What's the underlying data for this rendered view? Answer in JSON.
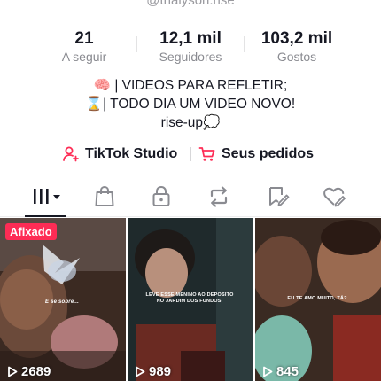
{
  "profile": {
    "handle": "@thaiyson.rise"
  },
  "stats": [
    {
      "value": "21",
      "label": "A seguir"
    },
    {
      "value": "12,1 mil",
      "label": "Seguidores"
    },
    {
      "value": "103,2 mil",
      "label": "Gostos"
    }
  ],
  "bio": {
    "line1": "🧠 | VIDEOS PARA REFLETIR;",
    "line2": "⌛| TODO DIA UM VIDEO NOVO!",
    "line3": "rise-up💭"
  },
  "actions": {
    "studio_label": "TikTok Studio",
    "orders_label": "Seus pedidos"
  },
  "tabs": [
    {
      "icon": "grid-menu-icon",
      "active": true
    },
    {
      "icon": "shopping-bag-icon"
    },
    {
      "icon": "lock-icon"
    },
    {
      "icon": "repost-icon"
    },
    {
      "icon": "bookmark-icon"
    },
    {
      "icon": "liked-heart-icon"
    }
  ],
  "videos": [
    {
      "pinned_label": "Afixado",
      "caption": "E se sobre...",
      "views": "2689"
    },
    {
      "caption_line1": "LEVE ESSE MENINO AO DEPÓSITO",
      "caption_line2": "NO JARDIM DOS FUNDOS.",
      "views": "989"
    },
    {
      "caption": "EU TE AMO MUITO, TÁ?",
      "views": "845"
    }
  ],
  "colors": {
    "accent": "#fe2c55",
    "text": "#161823",
    "muted": "#8a8b91"
  }
}
